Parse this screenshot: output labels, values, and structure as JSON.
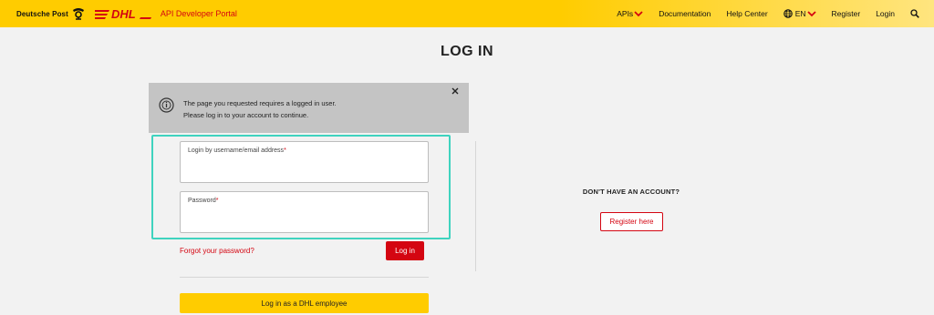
{
  "header": {
    "brand_text": "Deutsche Post",
    "portal_title": "API Developer Portal",
    "nav": {
      "apis": "APIs",
      "documentation": "Documentation",
      "help_center": "Help Center",
      "language": "EN",
      "register": "Register",
      "login": "Login"
    },
    "icons": [
      "post-horn-icon",
      "dhl-logo",
      "chevron-down-icon",
      "globe-icon",
      "search-icon"
    ]
  },
  "page": {
    "title": "LOG IN"
  },
  "alert": {
    "line1": "The page you requested requires a logged in user.",
    "line2": "Please log in to your account to continue.",
    "icons": [
      "info-icon",
      "close-icon"
    ]
  },
  "form": {
    "username_label": "Login by username/email address",
    "password_label": "Password",
    "required_mark": "*",
    "forgot_password": "Forgot your password?",
    "login_button": "Log in",
    "dhl_employee_button": "Log in as a DHL employee"
  },
  "signup": {
    "heading": "DON'T HAVE AN ACCOUNT?",
    "register_button": "Register here"
  },
  "colors": {
    "brand_yellow": "#ffcc00",
    "brand_red": "#d40511",
    "highlight": "#3fd3bf"
  }
}
